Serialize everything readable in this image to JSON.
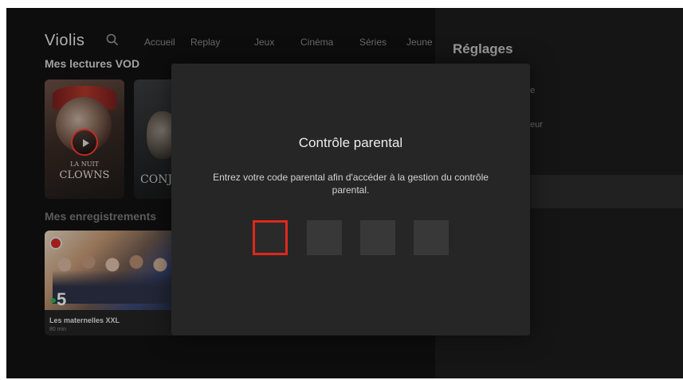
{
  "header": {
    "logo": "Violis",
    "nav": [
      "Accueil",
      "Replay",
      "Jeux",
      "Cinéma",
      "Séries",
      "Jeune"
    ]
  },
  "sections": {
    "vod_title": "Mes lectures VOD",
    "recordings_title": "Mes enregistrements"
  },
  "posters": {
    "clowns_line1": "LA NUIT",
    "clowns_line2": "CLOWNS",
    "conj": "CONJ"
  },
  "recording": {
    "channel": "5",
    "title": "Les maternelles XXL",
    "duration": "80 min"
  },
  "settings": {
    "title": "Réglages",
    "items_partial": [
      "me",
      "ateur",
      "le"
    ]
  },
  "modal": {
    "title": "Contrôle parental",
    "message": "Entrez votre code parental afin d'accéder à la gestion du contrôle parental.",
    "pin_length": 4,
    "active_index": 0,
    "accent_color": "#e0281c"
  },
  "icons": {
    "search": "search-icon",
    "play": "play-icon"
  }
}
